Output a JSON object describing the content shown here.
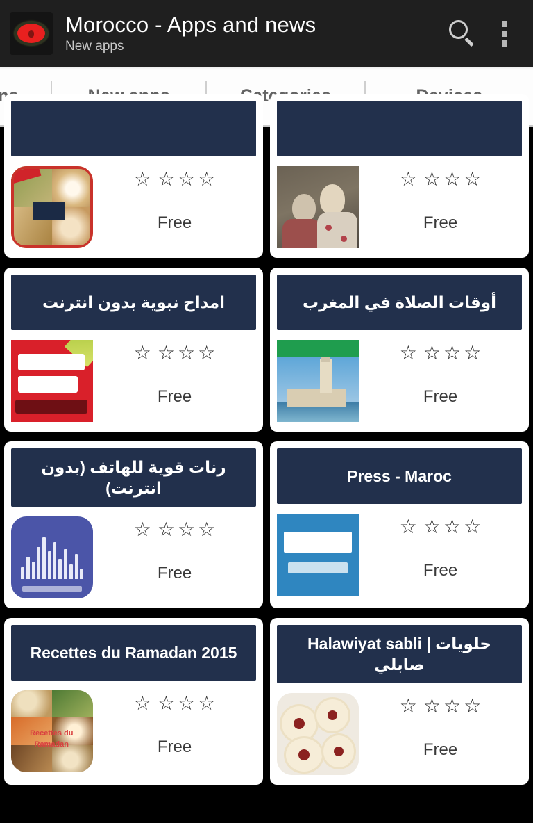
{
  "header": {
    "logo_icon": "morocco-flag-logo",
    "title": "Morocco - Apps and news",
    "subtitle": "New apps",
    "search_icon": "search-icon",
    "overflow_icon": "overflow-menu-icon",
    "background_color": "#1f1f1f",
    "title_color": "#ffffff"
  },
  "tabs": [
    {
      "label": "ations",
      "selected": false
    },
    {
      "label": "New apps",
      "selected": true
    },
    {
      "label": "Categories",
      "selected": false
    },
    {
      "label": "Devices",
      "selected": false
    }
  ],
  "theme": {
    "page_background": "#000000",
    "card_background": "#ffffff",
    "card_header_navy": "#22304c",
    "tab_text": "#636363",
    "price_text": "#3a3a3a"
  },
  "apps": [
    {
      "title": "",
      "title_cut_off": true,
      "rating_stars": 4,
      "rating_filled": 0,
      "price": "Free",
      "icon": "ramadan-sweets-collage-icon",
      "art": "food1",
      "rounded": true
    },
    {
      "title": "",
      "title_cut_off": true,
      "rating_stars": 4,
      "rating_filled": 0,
      "price": "Free",
      "icon": "two-people-photo-icon",
      "art": "people",
      "rounded": false
    },
    {
      "title": "امداح نبوية بدون انترنت",
      "rtl": true,
      "rating_stars": 4,
      "rating_filled": 0,
      "price": "Free",
      "icon": "amdah-nabawiya-red-icon",
      "art": "red",
      "rounded": false
    },
    {
      "title": "أوقات الصلاة في المغرب",
      "rtl": true,
      "rating_stars": 4,
      "rating_filled": 0,
      "price": "Free",
      "icon": "hassan-mosque-prayer-times-icon",
      "art": "mosque",
      "rounded": false
    },
    {
      "title": "رنات قوية للهاتف (بدون انترنت)",
      "rtl": true,
      "rating_stars": 4,
      "rating_filled": 0,
      "price": "Free",
      "icon": "ringtone-waveform-icon",
      "art": "wave",
      "rounded": true
    },
    {
      "title": "Press - Maroc",
      "rtl": false,
      "rating_stars": 4,
      "rating_filled": 0,
      "price": "Free",
      "icon": "maroc-press-icon",
      "art": "press",
      "rounded": false
    },
    {
      "title": "Recettes du Ramadan 2015",
      "rtl": false,
      "rating_stars": 4,
      "rating_filled": 0,
      "price": "Free",
      "icon": "recettes-ramadan-collage-icon",
      "art": "recipes",
      "rounded": true,
      "art_label": "Recettes du Ramadan"
    },
    {
      "title": "Halawiyat sabli | حلويات صابلي",
      "rtl": false,
      "rating_stars": 4,
      "rating_filled": 0,
      "price": "Free",
      "icon": "sabli-cookies-icon",
      "art": "cookies",
      "rounded": true
    }
  ],
  "star_glyph": "☆"
}
